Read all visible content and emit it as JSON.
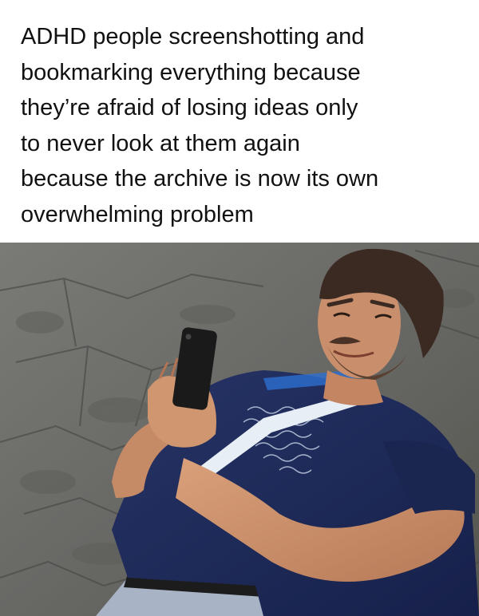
{
  "caption": {
    "lines": [
      "ADHD people screenshotting and",
      "bookmarking everything because",
      "they’re afraid of losing ideas only",
      "to never look at them again",
      "because the archive is now its own",
      "overwhelming problem"
    ]
  },
  "photo": {
    "subject": "man lying on stone pavement looking at phone and smiling",
    "colors": {
      "pavement": "#6f6f6c",
      "pavement_dark": "#4a4a48",
      "shirt": "#1e2a52",
      "skin": "#c98f6c",
      "hair": "#3b2a22",
      "phone": "#1a1a1a",
      "lanyard": "#e8eef5",
      "jeans": "#a9b3c6"
    }
  }
}
